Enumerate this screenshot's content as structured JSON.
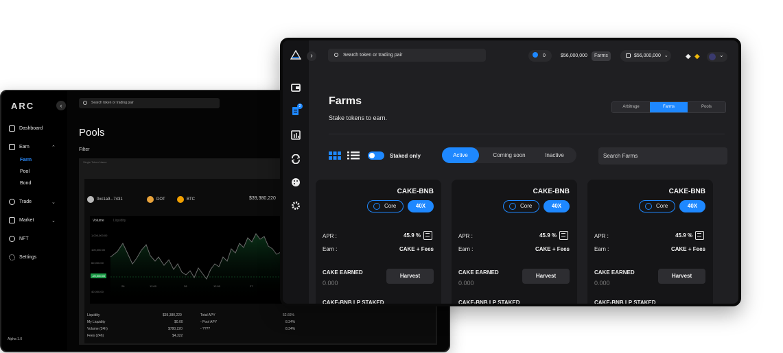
{
  "back": {
    "logo": "ARC",
    "collapse_icon": "‹",
    "search_placeholder": "Search token or trading pair",
    "nav": {
      "dashboard": "Dashboard",
      "earn": "Earn",
      "farm": "Farm",
      "pool": "Pool",
      "bond": "Bond",
      "trade": "Trade",
      "market": "Market",
      "nft": "NFT",
      "settings": "Settings"
    },
    "version": "Alpha 1.0",
    "title": "Pools",
    "filter_label": "Filter",
    "panel_head": "Single Token Name",
    "tokens": [
      {
        "label": "0xc1a9...7431"
      },
      {
        "label": "DOT"
      },
      {
        "label": "BTC"
      }
    ],
    "amount": "$39,380,220",
    "chart_tabs": [
      "Volume",
      "Liquidity"
    ],
    "y_ticks": [
      "1,000,000.00",
      "100,000.00",
      "60,000.00",
      "-20,000.00",
      "40,000.00"
    ],
    "x_ticks": [
      "26",
      "12:00",
      "28",
      "12:00",
      "27",
      "12:00"
    ],
    "stats_left": [
      {
        "label": "Liquidity",
        "value": "$39,380,220"
      },
      {
        "label": "My Liquidity",
        "value": "$0.00"
      },
      {
        "label": "Volume (24h)",
        "value": "$780,220"
      },
      {
        "label": "Fees (24h)",
        "value": "$4,322"
      }
    ],
    "stats_right": [
      {
        "label": "Total APY",
        "value": "52.66%"
      },
      {
        "label": "- Pool APY",
        "value": "8.34%"
      },
      {
        "label": "- ????",
        "value": "8.34%"
      }
    ]
  },
  "front": {
    "search_placeholder": "Search token or trading pair",
    "badge_count": "0",
    "sidebar_badge": "2",
    "price": "$56,000,000",
    "farms_tag": "Farms",
    "wallet_value": "$56,000,000",
    "page_title": "Farms",
    "page_subtitle": "Stake tokens to earn.",
    "tabs": [
      "Arbitrage",
      "Farms",
      "Pools"
    ],
    "staked_only": "Staked only",
    "status": [
      "Active",
      "Coming soon",
      "Inactive"
    ],
    "search_farms": "Search Farms",
    "cards": [
      {
        "pair": "CAKE-BNB",
        "core": "Core",
        "mult": "40X",
        "apr_label": "APR :",
        "apr": "45.9 %",
        "earn_label": "Earn :",
        "earn": "CAKE + Fees",
        "earned_label": "CAKE EARNED",
        "earned": "0.000",
        "harvest": "Harvest",
        "lp": "CAKE-BNB LP STAKED"
      },
      {
        "pair": "CAKE-BNB",
        "core": "Core",
        "mult": "40X",
        "apr_label": "APR :",
        "apr": "45.9 %",
        "earn_label": "Earn :",
        "earn": "CAKE + Fees",
        "earned_label": "CAKE EARNED",
        "earned": "0.000",
        "harvest": "Harvest",
        "lp": "CAKE-BNB LP STAKED"
      },
      {
        "pair": "CAKE-BNB",
        "core": "Core",
        "mult": "40X",
        "apr_label": "APR :",
        "apr": "45.9 %",
        "earn_label": "Earn :",
        "earn": "CAKE + Fees",
        "earned_label": "CAKE EARNED",
        "earned": "0.000",
        "harvest": "Harvest",
        "lp": "CAKE-BNB LP STAKED"
      }
    ]
  },
  "colors": {
    "accent": "#1e88ff",
    "background": "#1f1f22",
    "card": "#151517"
  }
}
